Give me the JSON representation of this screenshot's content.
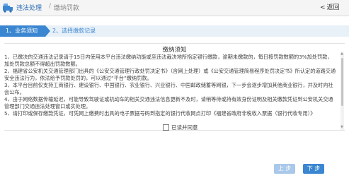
{
  "header": {
    "title": "违法处理",
    "separator": "/",
    "current": "缴纳罚款",
    "back_label": "返回"
  },
  "steps": [
    {
      "label": "1、业务须知"
    },
    {
      "label": "2、选择缴款记录"
    }
  ],
  "notice": {
    "title": "缴纳须知",
    "paragraphs": [
      "1、已缴决的交通违法记录请于15日内使用本平台违法缴纳功能或至违法裁决地所指定银行缴款，逾期未缴款的，每日按罚款数额的3%加处罚款，加处罚款总额不得超出罚款数额。",
      "2、福建省公安机关交通管理部门出具的《公安交通管理行政处罚决定书》（含网上处理）或《公安交通管理简易程序处罚决定书》所认定的道路交通安全违法行为，依法给予罚款处罚的，可以通过“平台”缴纳罚款。",
      "3、本平台目前仅支持工商银行、建设银行、中国银行、农业银行、兴业银行、中国邮政储蓄等网银，下一步会逐步增加其他商业银行，并及时向社会公布。",
      "4、由于网络数据传输延迟，可能导致驾驶证或机动车的相关交通违法信息更新不及时，请稍等待或持有效身份证明及相关缴款凭证到公安机关交通管理部门交通违法处理窗口或实处理。",
      "5、请打印或保存缴款凭证，可凭网上缴费时出具的电子票据号码到指定的银行代收网点打印《福建省政府非税收入票据（银行代收专用）》"
    ]
  },
  "agree": {
    "label": "已读并同意"
  },
  "buttons": {
    "prev": "上 步",
    "next": "下 步"
  },
  "colors": {
    "accent": "#3a86d1",
    "accent_light": "#a9c8ea",
    "header_title": "#2f6fb5"
  }
}
